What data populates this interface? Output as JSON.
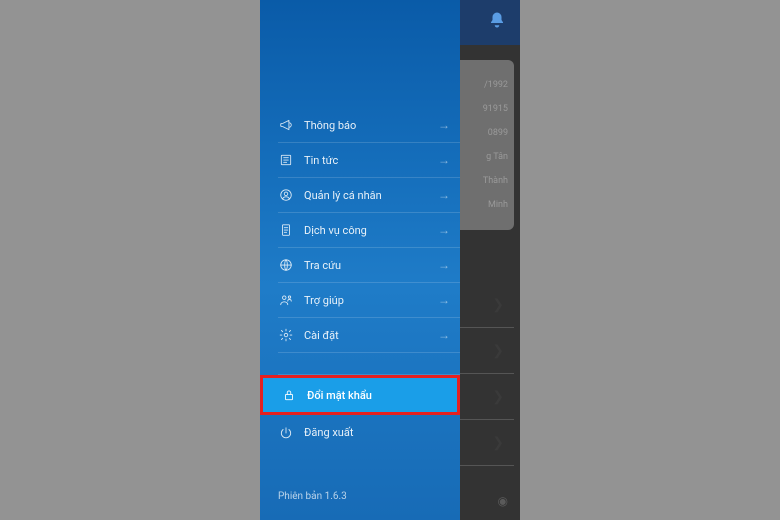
{
  "menu": {
    "items": [
      {
        "key": "notifications",
        "label": "Thông báo",
        "icon": "megaphone-icon"
      },
      {
        "key": "news",
        "label": "Tin tức",
        "icon": "newspaper-icon"
      },
      {
        "key": "personal",
        "label": "Quản lý cá nhân",
        "icon": "user-badge-icon"
      },
      {
        "key": "public-service",
        "label": "Dịch vụ công",
        "icon": "document-icon"
      },
      {
        "key": "lookup",
        "label": "Tra cứu",
        "icon": "globe-icon"
      },
      {
        "key": "help",
        "label": "Trợ giúp",
        "icon": "help-icon"
      },
      {
        "key": "settings",
        "label": "Cài đặt",
        "icon": "gear-icon"
      }
    ],
    "change_password_label": "Đổi mật khẩu",
    "logout_label": "Đăng xuất"
  },
  "footer": {
    "version_label": "Phiên bản 1.6.3"
  },
  "background": {
    "fragments": {
      "r1": "/1992",
      "r2": "91915",
      "r3": "0899",
      "r4": "g Tân",
      "r5": "Thành",
      "r6": "Minh"
    }
  }
}
